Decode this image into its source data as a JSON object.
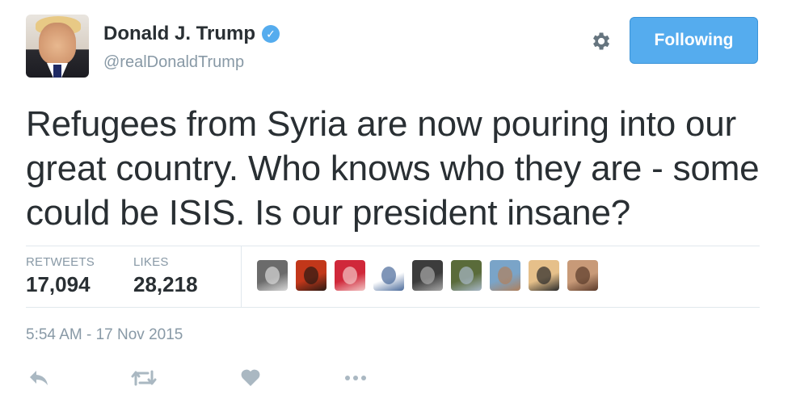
{
  "user": {
    "display_name": "Donald J. Trump",
    "handle": "@realDonaldTrump",
    "verified_mark": "✓"
  },
  "follow_button": {
    "label": "Following"
  },
  "tweet": {
    "text": "Refugees from Syria are now pouring into our great country. Who knows who they are - some could be ISIS. Is our president insane?",
    "timestamp": "5:54 AM - 17 Nov 2015"
  },
  "stats": {
    "retweets_label": "RETWEETS",
    "retweets_value": "17,094",
    "likes_label": "LIKES",
    "likes_value": "28,218"
  },
  "likers": [
    {
      "bg": "#6b6b6b",
      "accent": "#d9d9d9"
    },
    {
      "bg": "#c2371a",
      "accent": "#2b1a14"
    },
    {
      "bg": "#d0283a",
      "accent": "#f3c6c6"
    },
    {
      "bg": "#ffffff",
      "accent": "#4a6a9a"
    },
    {
      "bg": "#3c3c3c",
      "accent": "#a8a8a8"
    },
    {
      "bg": "#5a6b3a",
      "accent": "#a8b8c8"
    },
    {
      "bg": "#7aa4c8",
      "accent": "#b0805c"
    },
    {
      "bg": "#e6c08a",
      "accent": "#2a2a2a"
    },
    {
      "bg": "#c89a78",
      "accent": "#5a3a2a"
    }
  ],
  "icons": {
    "settings": "gear-icon",
    "verified": "verified-badge-icon",
    "reply": "reply-icon",
    "retweet": "retweet-icon",
    "like": "heart-icon",
    "more": "more-icon"
  },
  "colors": {
    "accent": "#55acee",
    "text": "#292f33",
    "muted": "#8899a6",
    "icon": "#aab8c2",
    "divider": "#e1e8ed"
  }
}
